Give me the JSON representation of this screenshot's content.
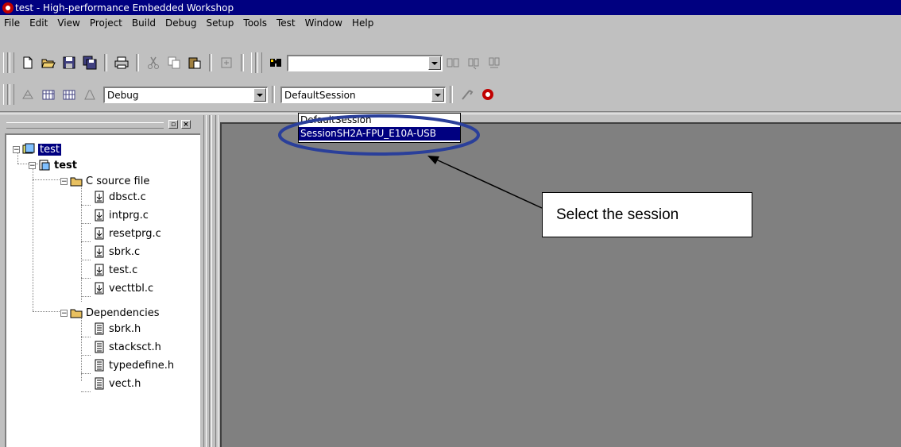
{
  "window": {
    "title": "test - High-performance Embedded Workshop"
  },
  "menu": [
    {
      "label": "File"
    },
    {
      "label": "Edit"
    },
    {
      "label": "View"
    },
    {
      "label": "Project"
    },
    {
      "label": "Build"
    },
    {
      "label": "Debug"
    },
    {
      "label": "Setup"
    },
    {
      "label": "Tools"
    },
    {
      "label": "Test"
    },
    {
      "label": "Window"
    },
    {
      "label": "Help"
    }
  ],
  "toolbar": {
    "find_value": "",
    "config_value": "Debug",
    "session_value": "DefaultSession"
  },
  "session_dropdown": {
    "options": [
      "DefaultSession",
      "SessionSH2A-FPU_E10A-USB"
    ],
    "highlighted": "SessionSH2A-FPU_E10A-USB"
  },
  "tree": {
    "workspace": "test",
    "project": "test",
    "folders": [
      {
        "name": "C source file",
        "files": [
          "dbsct.c",
          "intprg.c",
          "resetprg.c",
          "sbrk.c",
          "test.c",
          "vecttbl.c"
        ]
      },
      {
        "name": "Dependencies",
        "files": [
          "sbrk.h",
          "stacksct.h",
          "typedefine.h",
          "vect.h"
        ]
      }
    ]
  },
  "annotation": {
    "callout_text": "Select the session"
  },
  "colors": {
    "titlebar": "#000080",
    "highlight_ellipse": "#2a3f9a",
    "mdi_background": "#808080",
    "app_face": "#c0c0c0"
  }
}
